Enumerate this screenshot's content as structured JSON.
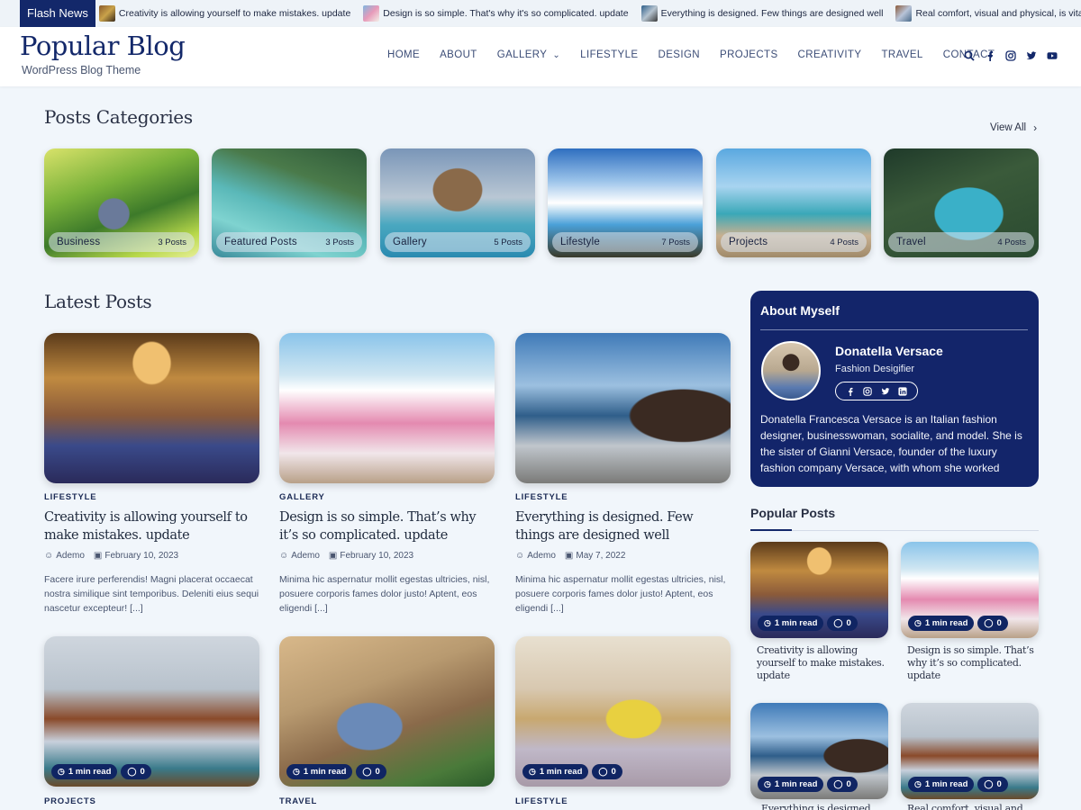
{
  "flash": {
    "label": "Flash News",
    "items": [
      {
        "text": "Creativity is allowing yourself to make mistakes. update"
      },
      {
        "text": "Design is so simple. That's why it's so complicated. update"
      },
      {
        "text": "Everything is designed. Few things are designed well"
      },
      {
        "text": "Real comfort, visual and physical, is vital to every r"
      }
    ]
  },
  "header": {
    "title": "Popular Blog",
    "tagline": "WordPress Blog Theme",
    "nav": [
      "HOME",
      "ABOUT",
      "GALLERY",
      "LIFESTYLE",
      "DESIGN",
      "PROJECTS",
      "CREATIVITY",
      "TRAVEL",
      "CONTACT"
    ],
    "icons": [
      "search-icon",
      "facebook-icon",
      "instagram-icon",
      "twitter-icon",
      "youtube-icon"
    ]
  },
  "categories": {
    "title": "Posts Categories",
    "view_all": "View All",
    "items": [
      {
        "name": "Business",
        "count": "3 Posts"
      },
      {
        "name": "Featured Posts",
        "count": "3 Posts"
      },
      {
        "name": "Gallery",
        "count": "5 Posts"
      },
      {
        "name": "Lifestyle",
        "count": "7 Posts"
      },
      {
        "name": "Projects",
        "count": "4 Posts"
      },
      {
        "name": "Travel",
        "count": "4 Posts"
      }
    ]
  },
  "latest": {
    "title": "Latest Posts",
    "posts": [
      {
        "category": "LIFESTYLE",
        "title": "Creativity is allowing yourself to make mistakes. update",
        "author": "Ademo",
        "date": "February 10, 2023",
        "excerpt": "Facere irure perferendis! Magni placerat occaecat nostra similique sint temporibus. Deleniti eius sequi nascetur excepteur! [...]"
      },
      {
        "category": "GALLERY",
        "title": "Design is so simple. That’s why it’s so complicated. update",
        "author": "Ademo",
        "date": "February 10, 2023",
        "excerpt": "Minima hic aspernatur mollit egestas ultricies, nisl, posuere corporis fames dolor justo! Aptent, eos eligendi [...]"
      },
      {
        "category": "LIFESTYLE",
        "title": "Everything is designed. Few things are designed well",
        "author": "Ademo",
        "date": "May 7, 2022",
        "excerpt": "Minima hic aspernatur mollit egestas ultricies, nisl, posuere corporis fames dolor justo! Aptent, eos eligendi [...]"
      },
      {
        "category": "PROJECTS",
        "read": "1 min read",
        "comments": "0"
      },
      {
        "category": "TRAVEL",
        "read": "1 min read",
        "comments": "0"
      },
      {
        "category": "LIFESTYLE",
        "read": "1 min read",
        "comments": "0"
      }
    ]
  },
  "about": {
    "title": "About Myself",
    "name": "Donatella Versace",
    "role": "Fashion Desigifier",
    "social": [
      "facebook-icon",
      "instagram-icon",
      "twitter-icon",
      "linkedin-icon"
    ],
    "text": "Donatella Francesca Versace is an Italian fashion designer, businesswoman, socialite, and model. She is the sister of Gianni Versace, founder of the luxury fashion company Versace, with whom she worked"
  },
  "popular": {
    "title": "Popular Posts",
    "posts": [
      {
        "read": "1 min read",
        "comments": "0",
        "title": "Creativity is allowing yourself to make mistakes. update"
      },
      {
        "read": "1 min read",
        "comments": "0",
        "title": "Design is so simple. That’s why it’s so complicated. update"
      },
      {
        "read": "1 min read",
        "comments": "0",
        "title": "Everything is designed"
      },
      {
        "read": "1 min read",
        "comments": "0",
        "title": "Real comfort, visual and"
      }
    ]
  },
  "colors": {
    "brand": "#13286a",
    "background": "#f1f6fb"
  }
}
